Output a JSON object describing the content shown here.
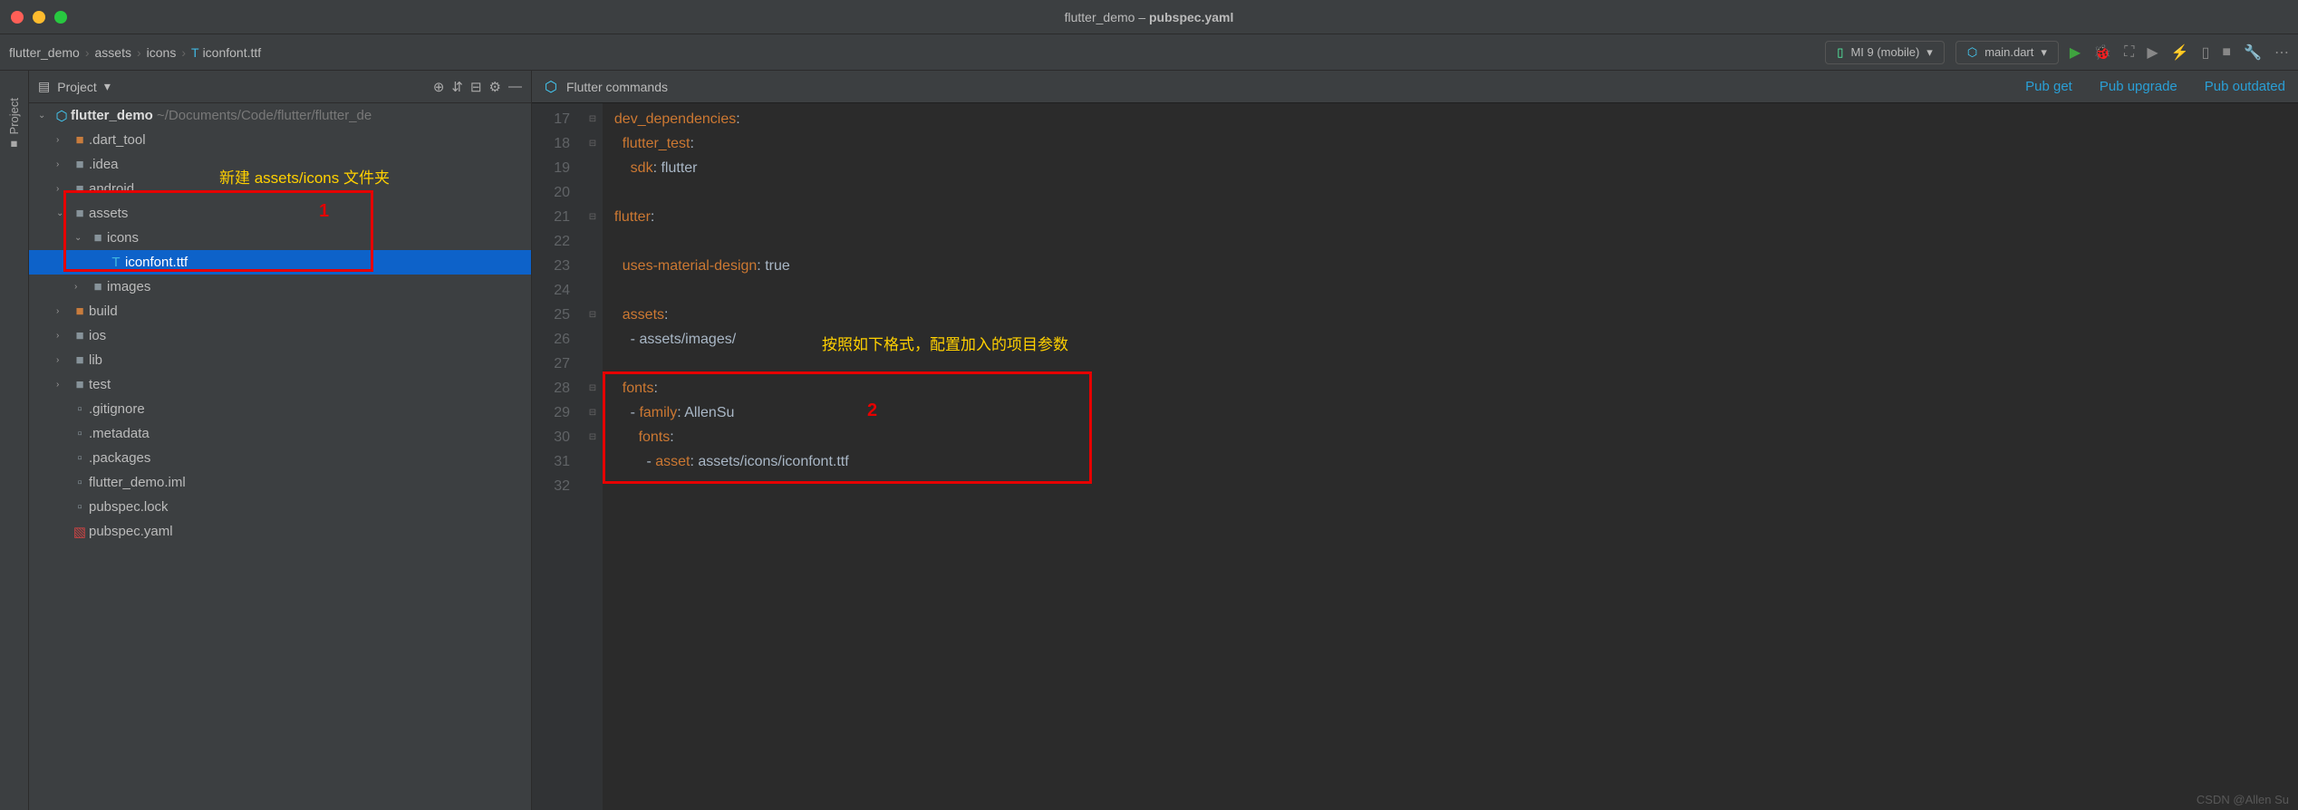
{
  "window": {
    "title_prefix": "flutter_demo – ",
    "title_file": "pubspec.yaml"
  },
  "breadcrumbs": [
    "flutter_demo",
    "assets",
    "icons",
    "iconfont.ttf"
  ],
  "device_selector": "MI 9 (mobile)",
  "config_selector": "main.dart",
  "project_panel": {
    "label": "Project",
    "root": {
      "name": "flutter_demo",
      "path": "~/Documents/Code/flutter/flutter_de"
    },
    "tree": [
      {
        "depth": 1,
        "arrow": "›",
        "icon": "folder",
        "name": ".dart_tool",
        "color": "#c87c3d"
      },
      {
        "depth": 1,
        "arrow": "›",
        "icon": "folder",
        "name": ".idea",
        "color": "#87939a"
      },
      {
        "depth": 1,
        "arrow": "›",
        "icon": "folder",
        "name": "android",
        "color": "#87939a"
      },
      {
        "depth": 1,
        "arrow": "⌄",
        "icon": "folder",
        "name": "assets",
        "color": "#87939a"
      },
      {
        "depth": 2,
        "arrow": "⌄",
        "icon": "folder",
        "name": "icons",
        "color": "#87939a"
      },
      {
        "depth": 3,
        "arrow": "",
        "icon": "font",
        "name": "iconfont.ttf",
        "selected": true
      },
      {
        "depth": 2,
        "arrow": "›",
        "icon": "folder",
        "name": "images",
        "color": "#87939a"
      },
      {
        "depth": 1,
        "arrow": "›",
        "icon": "folder",
        "name": "build",
        "color": "#c87c3d"
      },
      {
        "depth": 1,
        "arrow": "›",
        "icon": "folder",
        "name": "ios",
        "color": "#87939a"
      },
      {
        "depth": 1,
        "arrow": "›",
        "icon": "folder",
        "name": "lib",
        "color": "#87939a"
      },
      {
        "depth": 1,
        "arrow": "›",
        "icon": "folder",
        "name": "test",
        "color": "#87939a"
      },
      {
        "depth": 1,
        "arrow": "",
        "icon": "file",
        "name": ".gitignore"
      },
      {
        "depth": 1,
        "arrow": "",
        "icon": "file",
        "name": ".metadata"
      },
      {
        "depth": 1,
        "arrow": "",
        "icon": "file",
        "name": ".packages"
      },
      {
        "depth": 1,
        "arrow": "",
        "icon": "file",
        "name": "flutter_demo.iml"
      },
      {
        "depth": 1,
        "arrow": "",
        "icon": "file",
        "name": "pubspec.lock"
      },
      {
        "depth": 1,
        "arrow": "",
        "icon": "yaml",
        "name": "pubspec.yaml"
      }
    ]
  },
  "annotations": {
    "tree_label": "新建 assets/icons 文件夹",
    "editor_label": "按照如下格式，配置加入的项目参数",
    "num1": "1",
    "num2": "2"
  },
  "editor": {
    "commands_label": "Flutter commands",
    "links": [
      "Pub get",
      "Pub upgrade",
      "Pub outdated"
    ],
    "first_line": 17,
    "lines": [
      {
        "n": 17,
        "tokens": [
          [
            "p",
            "  "
          ],
          [
            "k",
            "dev_dependencies"
          ],
          [
            "p",
            ":"
          ]
        ]
      },
      {
        "n": 18,
        "tokens": [
          [
            "p",
            "    "
          ],
          [
            "k",
            "flutter_test"
          ],
          [
            "p",
            ":"
          ]
        ]
      },
      {
        "n": 19,
        "tokens": [
          [
            "p",
            "      "
          ],
          [
            "k",
            "sdk"
          ],
          [
            "p",
            ": flutter"
          ]
        ]
      },
      {
        "n": 20,
        "tokens": []
      },
      {
        "n": 21,
        "tokens": [
          [
            "p",
            "  "
          ],
          [
            "k",
            "flutter"
          ],
          [
            "p",
            ":"
          ]
        ]
      },
      {
        "n": 22,
        "tokens": []
      },
      {
        "n": 23,
        "tokens": [
          [
            "p",
            "    "
          ],
          [
            "k",
            "uses-material-design"
          ],
          [
            "p",
            ": true"
          ]
        ]
      },
      {
        "n": 24,
        "tokens": []
      },
      {
        "n": 25,
        "tokens": [
          [
            "p",
            "    "
          ],
          [
            "k",
            "assets"
          ],
          [
            "p",
            ":"
          ]
        ]
      },
      {
        "n": 26,
        "tokens": [
          [
            "p",
            "      - assets/images/"
          ]
        ]
      },
      {
        "n": 27,
        "tokens": []
      },
      {
        "n": 28,
        "tokens": [
          [
            "p",
            "    "
          ],
          [
            "k",
            "fonts"
          ],
          [
            "p",
            ":"
          ]
        ]
      },
      {
        "n": 29,
        "tokens": [
          [
            "p",
            "      - "
          ],
          [
            "k",
            "family"
          ],
          [
            "p",
            ": AllenSu"
          ]
        ]
      },
      {
        "n": 30,
        "tokens": [
          [
            "p",
            "        "
          ],
          [
            "k",
            "fonts"
          ],
          [
            "p",
            ":"
          ]
        ]
      },
      {
        "n": 31,
        "tokens": [
          [
            "p",
            "          - "
          ],
          [
            "k",
            "asset"
          ],
          [
            "p",
            ": assets/icons/iconfont.ttf"
          ]
        ]
      },
      {
        "n": 32,
        "tokens": []
      }
    ]
  },
  "watermark": "CSDN @Allen Su"
}
